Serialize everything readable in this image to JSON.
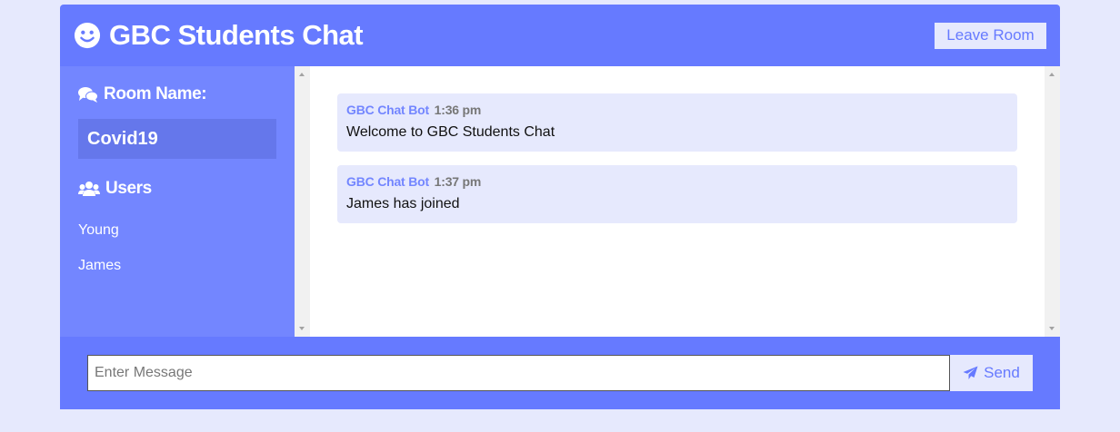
{
  "header": {
    "title": "GBC Students Chat",
    "logo_icon": "smile-icon",
    "leave_label": "Leave Room"
  },
  "sidebar": {
    "room_heading": "Room Name:",
    "room_icon": "comments-icon",
    "room_name": "Covid19",
    "users_heading": "Users",
    "users_icon": "users-icon",
    "users": [
      "Young",
      "James"
    ]
  },
  "messages": [
    {
      "author": "GBC Chat Bot",
      "time": "1:36 pm",
      "text": "Welcome to GBC Students Chat"
    },
    {
      "author": "GBC Chat Bot",
      "time": "1:37 pm",
      "text": "James has joined"
    }
  ],
  "composer": {
    "placeholder": "Enter Message",
    "value": "",
    "send_label": "Send",
    "send_icon": "paper-plane-icon"
  },
  "colors": {
    "primary": "#667aff",
    "sidebar": "#7386ff",
    "light": "#e6e9fd",
    "room_highlight": "#6577eb"
  }
}
